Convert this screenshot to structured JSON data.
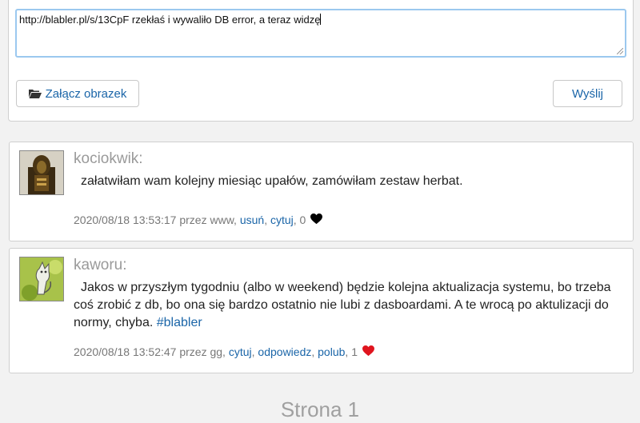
{
  "composer": {
    "text_value": "http://blabler.pl/s/13CpF rzekłaś i wywaliło DB error, a teraz widzę",
    "attach_label": "Załącz obrazek",
    "send_label": "Wyślij"
  },
  "posts": [
    {
      "author": "kociokwik:",
      "text": "załatwiłam wam kolejny miesiąc upałów, zamówiłam zestaw herbat.",
      "timestamp": "2020/08/18 13:53:17",
      "via": "przez www,",
      "actions": [
        "usuń",
        "cytuj"
      ],
      "like_count": "0",
      "heart_color": "#000000"
    },
    {
      "author": "kaworu:",
      "text": "Jakos w przyszłym tygodniu (albo w weekend) będzie kolejna aktualizacja systemu, bo trzeba coś zrobić z db, bo ona się bardzo ostatnio nie lubi z dasboardami. A te wrocą po aktulizacji do normy, chyba.",
      "hashtag": "#blabler",
      "timestamp": "2020/08/18 13:52:47",
      "via": "przez gg,",
      "actions": [
        "cytuj",
        "odpowiedz",
        "polub"
      ],
      "like_count": "1",
      "heart_color": "#e0141e"
    }
  ],
  "pager": {
    "label": "Strona 1"
  },
  "icons": {
    "attach": "folder-open-icon",
    "like": "heart-icon"
  }
}
